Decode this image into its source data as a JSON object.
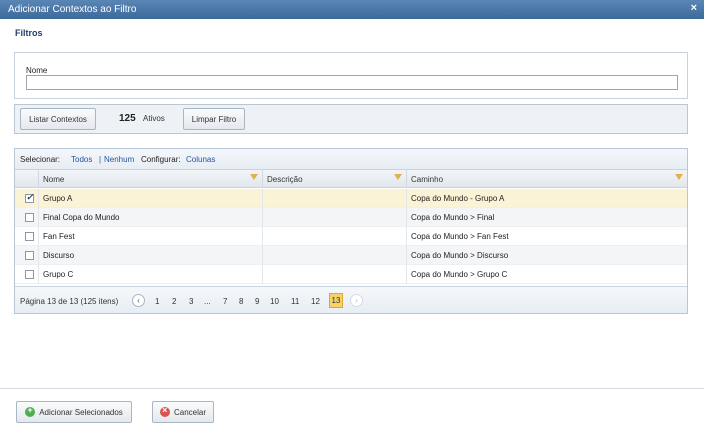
{
  "dialog": {
    "title": "Adicionar Contextos ao Filtro",
    "close_label": "×"
  },
  "filters": {
    "section_title": "Filtros",
    "name_label": "Nome",
    "name_value": ""
  },
  "toolbar": {
    "list_button": "Listar Contextos",
    "active_count": "125",
    "active_label": "Ativos",
    "clear_button": "Limpar Filtro"
  },
  "selection_bar": {
    "select_label": "Selecionar:",
    "all": "Todos",
    "separator": "|",
    "none": "Nenhum",
    "configure_label": "Configurar:",
    "columns": "Colunas"
  },
  "columns": [
    "Nome",
    "Descrição",
    "Caminho"
  ],
  "rows": [
    {
      "checked": true,
      "name": "Grupo A",
      "description": "",
      "path": "Copa do Mundo - Grupo A"
    },
    {
      "checked": false,
      "name": "Final Copa do Mundo",
      "description": "",
      "path": "Copa do Mundo > Final"
    },
    {
      "checked": false,
      "name": "Fan Fest",
      "description": "",
      "path": "Copa do Mundo > Fan Fest"
    },
    {
      "checked": false,
      "name": "Discurso",
      "description": "",
      "path": "Copa do Mundo > Discurso"
    },
    {
      "checked": false,
      "name": "Grupo C",
      "description": "",
      "path": "Copa do Mundo > Grupo C"
    }
  ],
  "pager": {
    "info": "Página 13 de 13 (125 itens)",
    "prev": "‹",
    "pages": [
      "1",
      "2",
      "3",
      "...",
      "7",
      "8",
      "9",
      "10",
      "11",
      "12",
      "13"
    ],
    "current": "13",
    "next": "›"
  },
  "footer": {
    "add_button": "Adicionar Selecionados",
    "cancel_button": "Cancelar"
  },
  "colors": {
    "title_bar": "#4a78a8",
    "selected_row": "#fbf3d5",
    "current_page": "#f7d26b",
    "link": "#2255a0"
  }
}
